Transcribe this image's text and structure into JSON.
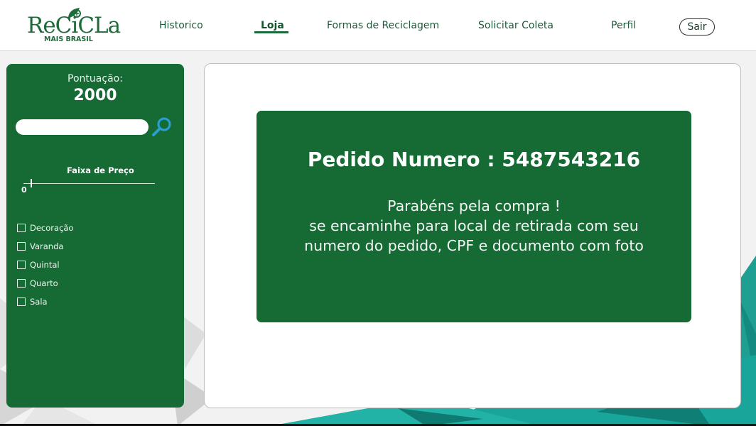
{
  "brand": {
    "name": "ReCiCLa",
    "subtitle": "MAIS BRASIL",
    "color": "#1d6b3a"
  },
  "nav": {
    "items": [
      {
        "label": "Historico",
        "active": false
      },
      {
        "label": "Loja",
        "active": true
      },
      {
        "label": "Formas de Reciclagem",
        "active": false
      },
      {
        "label": "Solicitar Coleta",
        "active": false
      },
      {
        "label": "Perfil",
        "active": false
      }
    ],
    "logout_label": "Sair"
  },
  "sidebar": {
    "score_label": "Pontuação:",
    "score_value": "2000",
    "search": {
      "value": "",
      "placeholder": ""
    },
    "search_icon": "magnifier-icon",
    "price_filter": {
      "label": "Faixa de Preço",
      "min_label": "0",
      "level": 0
    },
    "categories": [
      {
        "label": "Decoração",
        "checked": false
      },
      {
        "label": "Varanda",
        "checked": false
      },
      {
        "label": "Quintal",
        "checked": false
      },
      {
        "label": "Quarto",
        "checked": false
      },
      {
        "label": "Sala",
        "checked": false
      }
    ],
    "color": "#166b34"
  },
  "order": {
    "title": "Pedido Numero : 5487543216",
    "message_lines": [
      "Parabéns pela compra !",
      "se encaminhe para local de retirada com seu",
      "numero do pedido, CPF e documento com foto"
    ],
    "color": "#166b34"
  },
  "colors": {
    "accent": "#1a6b3a",
    "teal_art": "#1aa59a",
    "search_icon": "#2a9fd6"
  }
}
